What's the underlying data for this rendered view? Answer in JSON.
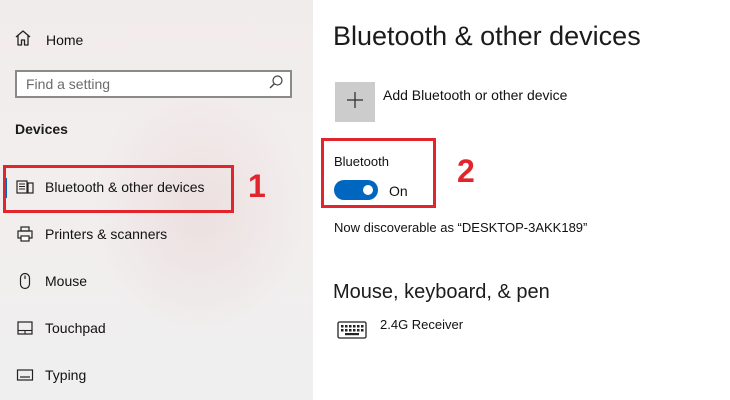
{
  "sidebar": {
    "home": {
      "label": "Home",
      "icon": "home-icon"
    },
    "search": {
      "placeholder": "Find a setting",
      "icon": "search-icon"
    },
    "section_heading": "Devices",
    "items": [
      {
        "label": "Bluetooth & other devices",
        "icon": "bluetooth-devices-icon",
        "selected": true
      },
      {
        "label": "Printers & scanners",
        "icon": "printer-icon",
        "selected": false
      },
      {
        "label": "Mouse",
        "icon": "mouse-icon",
        "selected": false
      },
      {
        "label": "Touchpad",
        "icon": "touchpad-icon",
        "selected": false
      },
      {
        "label": "Typing",
        "icon": "keyboard-typing-icon",
        "selected": false
      }
    ]
  },
  "main": {
    "title": "Bluetooth & other devices",
    "add_device": {
      "label": "Add Bluetooth or other device",
      "icon": "plus-icon"
    },
    "bluetooth": {
      "label": "Bluetooth",
      "state_text": "On",
      "enabled": true
    },
    "discoverable_text": "Now discoverable as “DESKTOP-3AKK189”",
    "section_mkp": {
      "heading": "Mouse, keyboard, & pen",
      "devices": [
        {
          "name": "2.4G Receiver",
          "icon": "keyboard-icon"
        }
      ]
    }
  },
  "annotations": {
    "marker_1": "1",
    "marker_2": "2"
  },
  "colors": {
    "accent": "#0067c0",
    "highlight": "#e2252c",
    "sidebar_bg": "#f1ecec",
    "add_button_bg": "#cccccc"
  }
}
